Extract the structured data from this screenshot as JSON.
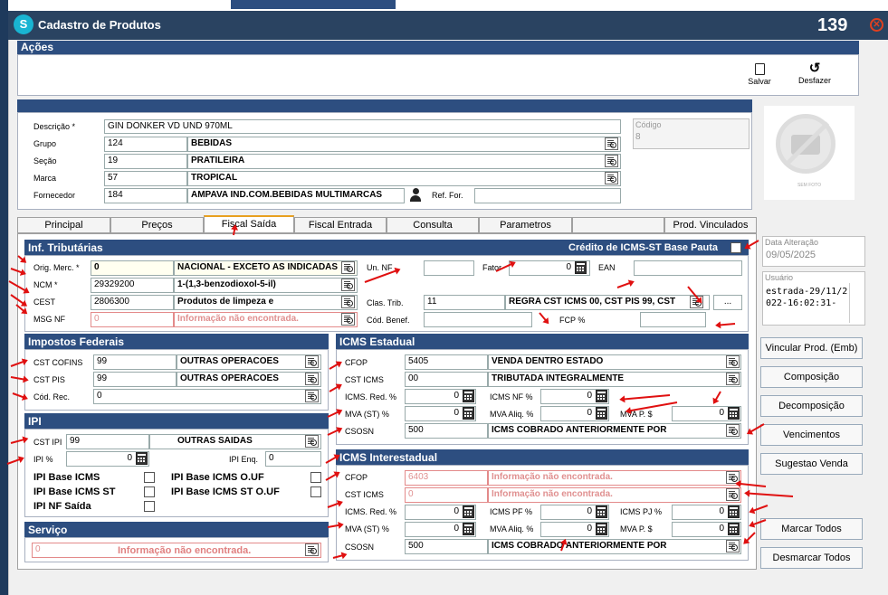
{
  "window": {
    "title": "Cadastro de Produtos",
    "number": "139",
    "logo": "S"
  },
  "acoes": {
    "title": "Ações",
    "salvar": "Salvar",
    "desfazer": "Desfazer"
  },
  "produto": {
    "descricao_label": "Descrição *",
    "descricao": "GIN DONKER VD UND 970ML",
    "grupo_label": "Grupo",
    "grupo_code": "124",
    "grupo_name": "BEBIDAS",
    "secao_label": "Seção",
    "secao_code": "19",
    "secao_name": "PRATILEIRA",
    "marca_label": "Marca",
    "marca_code": "57",
    "marca_name": "TROPICAL",
    "fornecedor_label": "Fornecedor",
    "fornecedor_code": "184",
    "fornecedor_name": "AMPAVA IND.COM.BEBIDAS MULTIMARCAS",
    "ref_for_label": "Ref. For.",
    "ref_for": "",
    "codigo_label": "Código",
    "codigo": "8"
  },
  "foto": {
    "caption": "SEM FOTO"
  },
  "tabs": [
    "Principal",
    "Preços",
    "Fiscal Saída",
    "Fiscal Entrada",
    "Consulta",
    "Parametros",
    "",
    "Prod. Vinculados"
  ],
  "inf": {
    "title": "Inf. Tributárias",
    "credito_label": "Crédito de ICMS-ST Base Pauta",
    "orig_label": "Orig. Merc. *",
    "orig_code": "0",
    "orig_name": "NACIONAL - EXCETO AS INDICADAS",
    "ncm_label": "NCM *",
    "ncm_code": "29329200",
    "ncm_name": "1-(1,3-benzodioxol-5-il)",
    "cest_label": "CEST",
    "cest_code": "2806300",
    "cest_name": "Produtos de limpeza e",
    "msg_label": "MSG NF",
    "msg_code": "0",
    "msg_name": "Informação não encontrada.",
    "un_nf_label": "Un. NF",
    "fator_label": "Fator",
    "fator": "0",
    "ean_label": "EAN",
    "clas_label": "Clas. Trib.",
    "clas_code": "11",
    "clas_name": "REGRA CST ICMS 00, CST PIS 99, CST",
    "cod_benef_label": "Cód. Benef.",
    "fcp_label": "FCP %",
    "more": "..."
  },
  "federais": {
    "title": "Impostos Federais",
    "cofins_label": "CST COFINS",
    "cofins_code": "99",
    "cofins_name": "OUTRAS OPERACOES",
    "pis_label": "CST PIS",
    "pis_code": "99",
    "pis_name": "OUTRAS OPERACOES",
    "rec_label": "Cód. Rec.",
    "rec": "0"
  },
  "ipi": {
    "title": "IPI",
    "cst_label": "CST IPI",
    "cst_code": "99",
    "cst_name": "OUTRAS SAIDAS",
    "pct_label": "IPI %",
    "pct": "0",
    "enq_label": "IPI Enq.",
    "enq": "0",
    "base_icms": "IPI Base ICMS",
    "base_icms_st": "IPI Base ICMS ST",
    "nf_saida": "IPI NF Saída",
    "base_icms_uf": "IPI Base ICMS O.UF",
    "base_icms_st_uf": "IPI Base ICMS ST O.UF"
  },
  "servico": {
    "title": "Serviço",
    "code": "0",
    "name": "Informação não encontrada."
  },
  "icms_est": {
    "title": "ICMS Estadual",
    "cfop_label": "CFOP",
    "cfop_code": "5405",
    "cfop_name": "VENDA DENTRO ESTADO",
    "cst_label": "CST ICMS",
    "cst_code": "00",
    "cst_name": "TRIBUTADA INTEGRALMENTE",
    "red_label": "ICMS. Red. %",
    "red": "0",
    "nf_label": "ICMS NF %",
    "nf": "0",
    "mva_label": "MVA (ST) %",
    "mva": "0",
    "mva_aliq_label": "MVA Aliq. %",
    "mva_aliq": "0",
    "mva_p_label": "MVA P. $",
    "mva_p": "0",
    "csosn_label": "CSOSN",
    "csosn_code": "500",
    "csosn_name": "ICMS COBRADO ANTERIORMENTE POR"
  },
  "icms_inter": {
    "title": "ICMS Interestadual",
    "cfop_label": "CFOP",
    "cfop_code": "6403",
    "cfop_name": "Informação não encontrada.",
    "cst_label": "CST ICMS",
    "cst_code": "0",
    "cst_name": "Informação não encontrada.",
    "red_label": "ICMS. Red. %",
    "red": "0",
    "pf_label": "ICMS PF %",
    "pf": "0",
    "pj_label": "ICMS PJ %",
    "pj": "0",
    "mva_label": "MVA (ST) %",
    "mva": "0",
    "mva_aliq_label": "MVA Aliq. %",
    "mva_aliq": "0",
    "mva_p_label": "MVA P. $",
    "mva_p": "0",
    "csosn_label": "CSOSN",
    "csosn_code": "500",
    "csosn_name": "ICMS COBRADO ANTERIORMENTE POR"
  },
  "side": {
    "data_label": "Data Alteração",
    "data": "09/05/2025",
    "usuario_label": "Usuário",
    "usuario": "estrada-29/11/2022-16:02:31-",
    "vincular": "Vincular Prod. (Emb)",
    "composicao": "Composição",
    "decomposicao": "Decomposição",
    "vencimentos": "Vencimentos",
    "sugestao": "Sugestao Venda",
    "marcar": "Marcar Todos",
    "desmarcar": "Desmarcar Todos"
  }
}
